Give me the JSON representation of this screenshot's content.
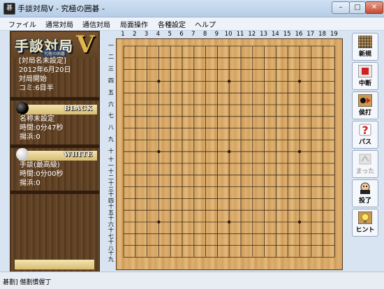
{
  "window": {
    "title": "手談対局V - 究極の囲碁 -",
    "icon_text": "碁"
  },
  "menu": {
    "items": [
      "ファイル",
      "通常対局",
      "通信対局",
      "局面操作",
      "各種設定",
      "ヘルプ"
    ]
  },
  "logo": {
    "text": "手談対局",
    "version": "V",
    "subtitle": "究極の囲碁"
  },
  "game_info": {
    "name": "[対局名未設定]",
    "date": "2012年6月20日",
    "status": "対局開始",
    "komi": "コミ:6目半"
  },
  "black": {
    "color_label": "BLACK",
    "name": "名称未設定",
    "time": "時間:0分47秒",
    "captures": "揚浜:0"
  },
  "white": {
    "color_label": "WHITE",
    "name": "手談(最高級)",
    "time": "時間:0分00秒",
    "captures": "揚浜:0"
  },
  "board": {
    "size": 19,
    "col_labels": [
      "1",
      "2",
      "3",
      "4",
      "5",
      "6",
      "7",
      "8",
      "9",
      "10",
      "11",
      "12",
      "13",
      "14",
      "15",
      "16",
      "17",
      "18",
      "19"
    ],
    "row_labels": [
      "一",
      "二",
      "三",
      "四",
      "五",
      "六",
      "七",
      "八",
      "九",
      "十",
      "十一",
      "十二",
      "十三",
      "十四",
      "十五",
      "十六",
      "十七",
      "十八",
      "十九"
    ],
    "stones": []
  },
  "toolbar": {
    "buttons": [
      {
        "label": "新規",
        "icon": "new-grid-icon",
        "enabled": true
      },
      {
        "label": "中断",
        "icon": "suspend-icon",
        "enabled": true
      },
      {
        "label": "侯打",
        "icon": "undo-icon",
        "enabled": true
      },
      {
        "label": "パス",
        "icon": "pass-icon",
        "enabled": true
      },
      {
        "label": "まった",
        "icon": "wait-icon",
        "enabled": false
      },
      {
        "label": "投了",
        "icon": "resign-icon",
        "enabled": true
      },
      {
        "label": "ヒント",
        "icon": "hint-icon",
        "enabled": true
      }
    ]
  },
  "status_bar": {
    "text": "碁劃] 僣劃慣偓丁"
  },
  "colors": {
    "board_wood": "#d7a767",
    "panel_wood": "#5b3e22",
    "title_bg": "#cfe0f3"
  }
}
